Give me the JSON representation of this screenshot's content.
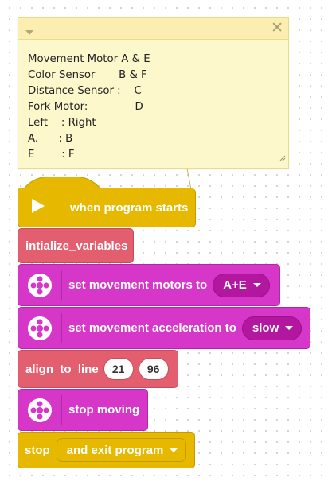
{
  "comment": {
    "lines": [
      "Movement Motor A & E",
      "Color Sensor       B & F",
      "Distance Sensor :    C",
      "Fork Motor:              D",
      "Left    : Right",
      "A.      : B",
      "E        : F"
    ],
    "collapse_icon": "chevron-down-icon",
    "close_icon": "close-icon"
  },
  "blocks": {
    "when_program_starts": {
      "label": "when program starts",
      "icon": "play-icon"
    },
    "initialize_variables": {
      "label": "intialize_variables"
    },
    "set_movement_motors": {
      "label": "set movement motors to",
      "value": "A+E",
      "icon": "motor-icon"
    },
    "set_movement_acceleration": {
      "label": "set movement acceleration to",
      "value": "slow",
      "icon": "motor-icon"
    },
    "align_to_line": {
      "label": "align_to_line",
      "arg1": "21",
      "arg2": "96"
    },
    "stop_moving": {
      "label": "stop moving",
      "icon": "motor-icon"
    },
    "stop": {
      "label": "stop",
      "value": "and exit program"
    }
  },
  "colors": {
    "events": "#e6b800",
    "my_blocks": "#e35f70",
    "movement": "#d637c8",
    "comment_bg": "#fdf7cc"
  }
}
